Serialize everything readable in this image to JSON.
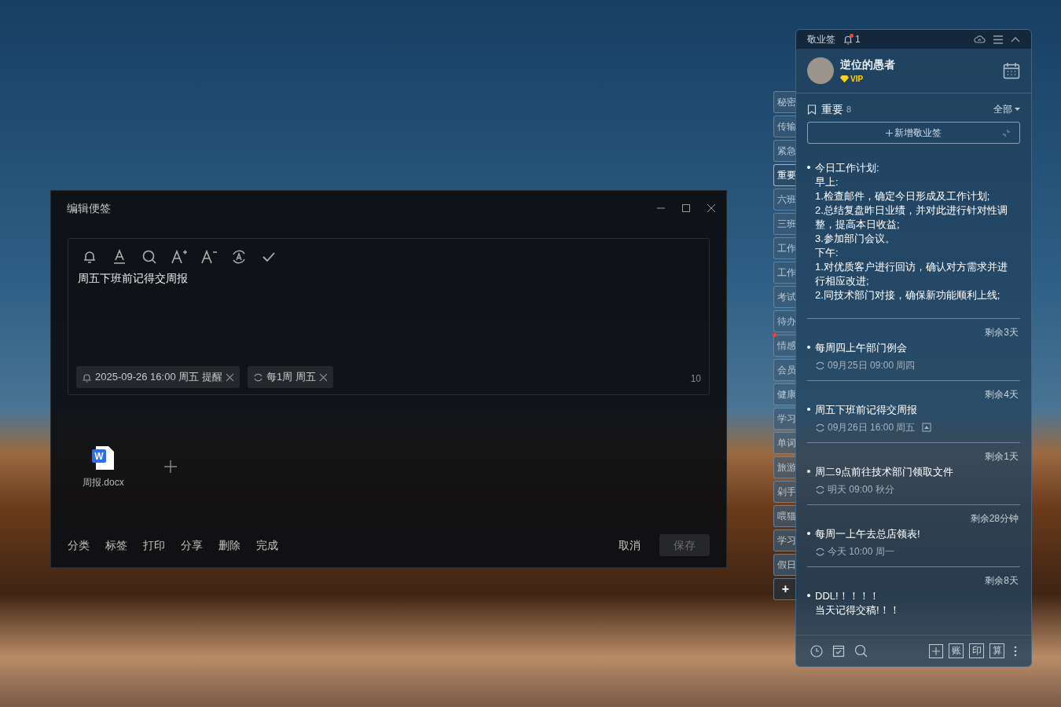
{
  "editor": {
    "title": "编辑便签",
    "content": "周五下班前记得交周报",
    "tags": [
      {
        "kind": "reminder",
        "text": "2025-09-26 16:00 周五 提醒"
      },
      {
        "kind": "repeat",
        "text": "每1周 周五"
      }
    ],
    "char_count": "10",
    "attachments": [
      {
        "name": "周报.docx",
        "icon_letter": "W"
      }
    ],
    "actions": [
      "分类",
      "标签",
      "打印",
      "分享",
      "删除",
      "完成"
    ],
    "cancel": "取消",
    "save": {
      "label": "保存",
      "disabled": true
    }
  },
  "side_tabs": [
    {
      "label": "秘密",
      "selected": false,
      "dot": false
    },
    {
      "label": "传输",
      "selected": false,
      "dot": false
    },
    {
      "label": "紧急",
      "selected": false,
      "dot": false
    },
    {
      "label": "重要",
      "selected": true,
      "dot": false
    },
    {
      "label": "六班",
      "selected": false,
      "dot": false
    },
    {
      "label": "三班",
      "selected": false,
      "dot": false
    },
    {
      "label": "工作",
      "selected": false,
      "dot": false
    },
    {
      "label": "工作",
      "selected": false,
      "dot": false
    },
    {
      "label": "考试",
      "selected": false,
      "dot": false
    },
    {
      "label": "待办",
      "selected": false,
      "dot": false
    },
    {
      "label": "情感",
      "selected": false,
      "dot": true
    },
    {
      "label": "会员",
      "selected": false,
      "dot": false
    },
    {
      "label": "健康",
      "selected": false,
      "dot": false
    },
    {
      "label": "学习",
      "selected": false,
      "dot": false
    },
    {
      "label": "单词",
      "selected": false,
      "dot": false
    },
    {
      "label": "旅游",
      "selected": false,
      "dot": false
    },
    {
      "label": "剁手",
      "selected": false,
      "dot": false
    },
    {
      "label": "喂猫",
      "selected": false,
      "dot": false
    },
    {
      "label": "学习",
      "selected": false,
      "dot": false
    },
    {
      "label": "假日",
      "selected": false,
      "dot": false
    }
  ],
  "add_tab": "+",
  "panel": {
    "app_name": "敬业签",
    "notification_count": "1",
    "user": {
      "name": "逆位的愚者",
      "badge": "VIP"
    },
    "category": {
      "name": "重要",
      "count": "8",
      "filter": "全部"
    },
    "add_button": "新增敬业签",
    "notes": [
      {
        "lines": [
          "今日工作计划:",
          "早上:",
          "1.检查邮件，确定今日形成及工作计划;",
          "2.总结复盘昨日业绩，并对此进行针对性调整，提高本日收益;",
          "3.参加部门会议。",
          "下午:",
          "1.对优质客户进行回访，确认对方需求并进行相应改进;",
          "2.同技术部门对接，确保新功能顺利上线;"
        ]
      },
      {
        "remaining": "剩余3天",
        "lines": [
          "每周四上午部门例会"
        ],
        "meta": "09月25日 09:00 周四",
        "attachment": false
      },
      {
        "remaining": "剩余4天",
        "lines": [
          "周五下班前记得交周报"
        ],
        "meta": "09月26日 16:00 周五",
        "attachment": true
      },
      {
        "remaining": "剩余1天",
        "lines": [
          "周二9点前往技术部门领取文件"
        ],
        "meta": "明天 09:00 秋分",
        "attachment": false
      },
      {
        "remaining": "剩余28分钟",
        "lines": [
          "每周一上午去总店领表!"
        ],
        "meta": "今天 10:00 周一",
        "attachment": false
      },
      {
        "remaining": "剩余8天",
        "lines": [
          "DDL!！！！！",
          "当天记得交稿!！！"
        ]
      }
    ],
    "bottom_tools": [
      "账",
      "印",
      "算"
    ]
  }
}
